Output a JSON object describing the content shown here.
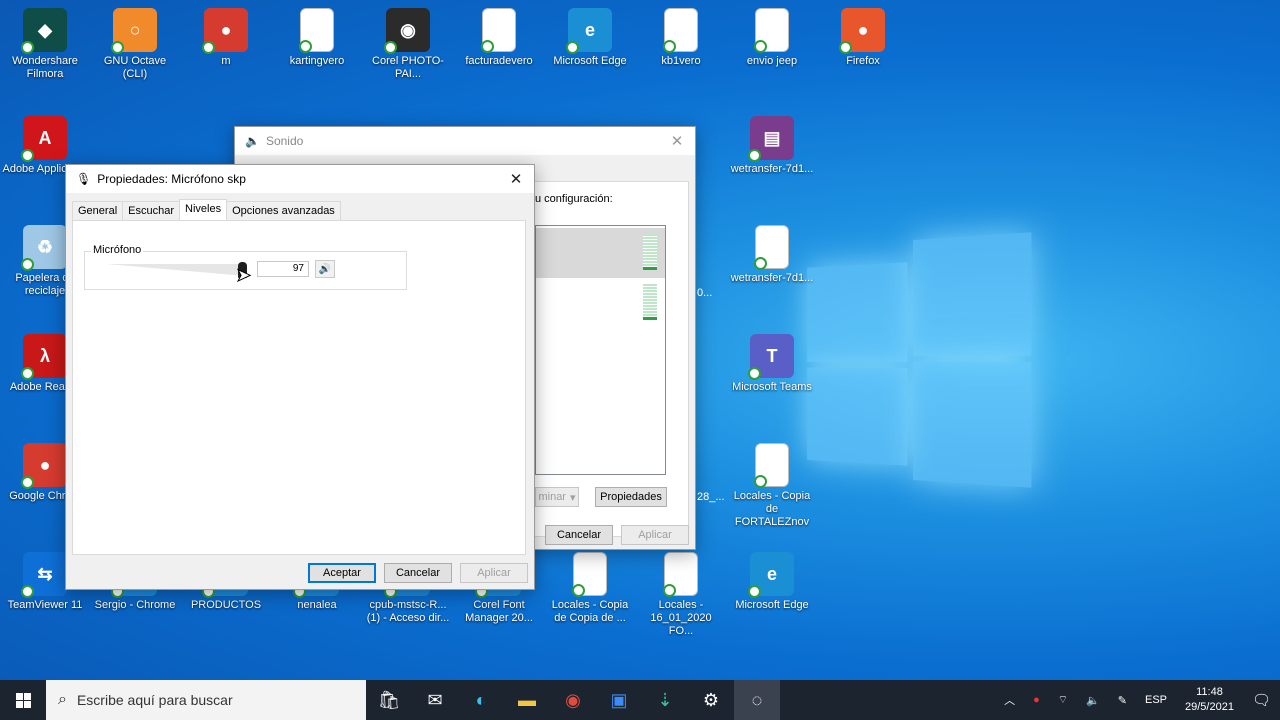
{
  "desktop_icons": [
    {
      "label": "Wondershare Filmora",
      "color": "#0f4d49",
      "glyph": "◆"
    },
    {
      "label": "GNU Octave (CLI)",
      "color": "#f08a2a",
      "glyph": "○"
    },
    {
      "label": "m",
      "color": "#d63b2f",
      "glyph": "●"
    },
    {
      "label": "kartingvero",
      "color": "doc",
      "glyph": ""
    },
    {
      "label": "Corel PHOTO-PAI...",
      "color": "#2b2b2b",
      "glyph": "◉"
    },
    {
      "label": "facturadevero",
      "color": "doc",
      "glyph": ""
    },
    {
      "label": "Microsoft Edge",
      "color": "#1a8fd4",
      "glyph": "e"
    },
    {
      "label": "kb1vero",
      "color": "doc",
      "glyph": ""
    },
    {
      "label": "envio jeep",
      "color": "doc",
      "glyph": ""
    },
    {
      "label": "Firefox",
      "color": "#e8572b",
      "glyph": "●"
    },
    {
      "label": "Adobe Applicati...",
      "color": "#d0161b",
      "glyph": "A"
    },
    {
      "label": "wetransfer-7d1...",
      "color": "#7a3c8c",
      "glyph": "▤"
    },
    {
      "label": "Papelera de reciclaje",
      "color": "#9fc8e6",
      "glyph": "♻"
    },
    {
      "label": "wetransfer-7d1...",
      "color": "doc",
      "glyph": ""
    },
    {
      "label": "Adobe Read...",
      "color": "#c81818",
      "glyph": "λ"
    },
    {
      "label": "Microsoft Teams",
      "color": "#5a5fc7",
      "glyph": "T"
    },
    {
      "label": "Google Chro...",
      "color": "#d63b2f",
      "glyph": "●"
    },
    {
      "label": "Locales - Copia de FORTALEZnov",
      "color": "doc",
      "glyph": ""
    },
    {
      "label": "TeamViewer 11",
      "color": "#0e6fd6",
      "glyph": "⇆"
    },
    {
      "label": "Sergio - Chrome",
      "color": "#1c8fe0",
      "glyph": ""
    },
    {
      "label": "PRODUCTOS",
      "color": "#1c8fe0",
      "glyph": ""
    },
    {
      "label": "nenalea",
      "color": "#1c8fe0",
      "glyph": ""
    },
    {
      "label": "cpub-mstsc-R... (1) - Acceso dir...",
      "color": "#1c8fe0",
      "glyph": ""
    },
    {
      "label": "Corel Font Manager 20...",
      "color": "#1c8fe0",
      "glyph": ""
    },
    {
      "label": "Locales - Copia de Copia de ...",
      "color": "doc",
      "glyph": ""
    },
    {
      "label": "Locales - 16_01_2020 FO...",
      "color": "doc",
      "glyph": ""
    },
    {
      "label": "Microsoft Edge",
      "color": "#1a8fd4",
      "glyph": "e"
    }
  ],
  "sound_window": {
    "title": "Sonido",
    "partial_text": "u configuración:",
    "partial_label_1": "28_...",
    "partial_label_2": "0...",
    "dropdown_label": "minar",
    "properties_button": "Propiedades",
    "cancel_button": "Cancelar",
    "apply_button": "Aplicar"
  },
  "properties_window": {
    "title": "Propiedades: Micrófono skp",
    "tabs": [
      "General",
      "Escuchar",
      "Niveles",
      "Opciones avanzadas"
    ],
    "active_tab": "Niveles",
    "group_label": "Micrófono",
    "level_value": "97",
    "level_fraction": 0.97,
    "ok_button": "Aceptar",
    "cancel_button": "Cancelar",
    "apply_button": "Aplicar"
  },
  "taskbar": {
    "search_placeholder": "Escribe aquí para buscar",
    "language": "ESP",
    "time": "11:48",
    "date": "29/5/2021"
  }
}
